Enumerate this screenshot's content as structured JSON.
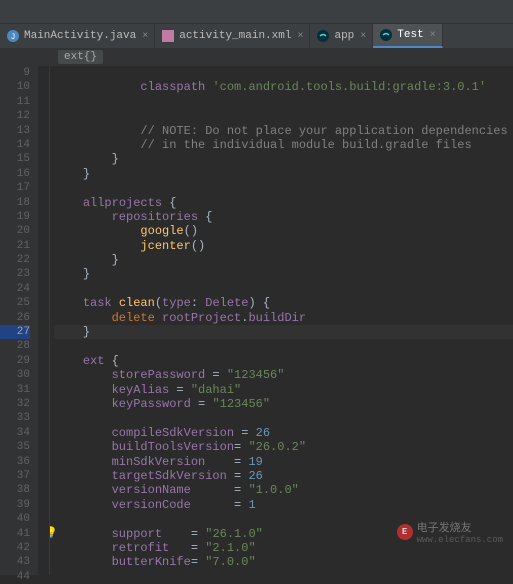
{
  "tabs": [
    {
      "label": "MainActivity.java",
      "icon": "java",
      "active": false
    },
    {
      "label": "activity_main.xml",
      "icon": "xml",
      "active": false
    },
    {
      "label": "app",
      "icon": "gradle",
      "active": false
    },
    {
      "label": "Test",
      "icon": "gradle",
      "active": true
    }
  ],
  "breadcrumb": "ext{}",
  "code_lines": {
    "l9": {
      "indent": 12,
      "tokens": [
        [
          "ident",
          "classpath"
        ],
        [
          "punct",
          " "
        ],
        [
          "str",
          "'com.android.tools.build:gradle:3.0.1'"
        ]
      ]
    },
    "l12": {
      "indent": 12,
      "tokens": [
        [
          "cmt",
          "// NOTE: Do not place your application dependencies her"
        ]
      ]
    },
    "l13": {
      "indent": 12,
      "tokens": [
        [
          "cmt",
          "// in the individual module build.gradle files"
        ]
      ]
    },
    "l14": {
      "indent": 8,
      "tokens": [
        [
          "punct",
          "}"
        ]
      ]
    },
    "l15": {
      "indent": 4,
      "tokens": [
        [
          "punct",
          "}"
        ]
      ]
    },
    "l17": {
      "indent": 4,
      "tokens": [
        [
          "ident",
          "allprojects"
        ],
        [
          "punct",
          " {"
        ]
      ]
    },
    "l18": {
      "indent": 8,
      "tokens": [
        [
          "ident",
          "repositories"
        ],
        [
          "punct",
          " {"
        ]
      ]
    },
    "l19": {
      "indent": 12,
      "tokens": [
        [
          "fn",
          "google"
        ],
        [
          "punct",
          "()"
        ]
      ]
    },
    "l20": {
      "indent": 12,
      "tokens": [
        [
          "fn",
          "jcenter"
        ],
        [
          "punct",
          "()"
        ]
      ]
    },
    "l21": {
      "indent": 8,
      "tokens": [
        [
          "punct",
          "}"
        ]
      ]
    },
    "l22": {
      "indent": 4,
      "tokens": [
        [
          "punct",
          "}"
        ]
      ]
    },
    "l24": {
      "indent": 4,
      "tokens": [
        [
          "ident",
          "task"
        ],
        [
          "punct",
          " "
        ],
        [
          "fn",
          "clean"
        ],
        [
          "punct",
          "("
        ],
        [
          "ident",
          "type"
        ],
        [
          "punct",
          ": "
        ],
        [
          "ident",
          "Delete"
        ],
        [
          "punct",
          ") {"
        ]
      ]
    },
    "l25": {
      "indent": 8,
      "tokens": [
        [
          "kw",
          "delete"
        ],
        [
          "punct",
          " "
        ],
        [
          "ident",
          "rootProject"
        ],
        [
          "punct",
          "."
        ],
        [
          "ident",
          "buildDir"
        ]
      ]
    },
    "l26": {
      "indent": 4,
      "tokens": [
        [
          "punct",
          "}"
        ]
      ]
    },
    "l28": {
      "indent": 4,
      "tokens": [
        [
          "ident",
          "ext"
        ],
        [
          "punct",
          " {"
        ]
      ]
    },
    "l29": {
      "indent": 8,
      "tokens": [
        [
          "ident",
          "storePassword"
        ],
        [
          "punct",
          " = "
        ],
        [
          "str",
          "\"123456\""
        ]
      ]
    },
    "l30": {
      "indent": 8,
      "tokens": [
        [
          "ident",
          "keyAlias"
        ],
        [
          "punct",
          " = "
        ],
        [
          "str",
          "\"dahai\""
        ]
      ]
    },
    "l31": {
      "indent": 8,
      "tokens": [
        [
          "ident",
          "keyPassword"
        ],
        [
          "punct",
          " = "
        ],
        [
          "str",
          "\"123456\""
        ]
      ]
    },
    "l33": {
      "indent": 8,
      "tokens": [
        [
          "ident",
          "compileSdkVersion"
        ],
        [
          "punct",
          " = "
        ],
        [
          "num",
          "26"
        ]
      ]
    },
    "l34": {
      "indent": 8,
      "tokens": [
        [
          "ident",
          "buildToolsVersion"
        ],
        [
          "punct",
          "= "
        ],
        [
          "str",
          "\"26.0.2\""
        ]
      ]
    },
    "l35": {
      "indent": 8,
      "tokens": [
        [
          "ident",
          "minSdkVersion"
        ],
        [
          "punct",
          "    = "
        ],
        [
          "num",
          "19"
        ]
      ]
    },
    "l36": {
      "indent": 8,
      "tokens": [
        [
          "ident",
          "targetSdkVersion"
        ],
        [
          "punct",
          " = "
        ],
        [
          "num",
          "26"
        ]
      ]
    },
    "l37": {
      "indent": 8,
      "tokens": [
        [
          "ident",
          "versionName"
        ],
        [
          "punct",
          "      = "
        ],
        [
          "str",
          "\"1.0.0\""
        ]
      ]
    },
    "l38": {
      "indent": 8,
      "tokens": [
        [
          "ident",
          "versionCode"
        ],
        [
          "punct",
          "      = "
        ],
        [
          "num",
          "1"
        ]
      ]
    },
    "l40": {
      "indent": 8,
      "tokens": [
        [
          "ident",
          "support"
        ],
        [
          "punct",
          "    = "
        ],
        [
          "str",
          "\"26.1.0\""
        ]
      ]
    },
    "l41": {
      "indent": 8,
      "tokens": [
        [
          "ident",
          "retrofit"
        ],
        [
          "punct",
          "   = "
        ],
        [
          "str",
          "\"2.1.0\""
        ]
      ]
    },
    "l42": {
      "indent": 8,
      "tokens": [
        [
          "ident",
          "butterKnife"
        ],
        [
          "punct",
          "= "
        ],
        [
          "str",
          "\"7.0.0\""
        ]
      ]
    }
  },
  "line_numbers": [
    9,
    10,
    11,
    12,
    13,
    14,
    15,
    16,
    17,
    18,
    19,
    20,
    21,
    22,
    23,
    24,
    25,
    26,
    27,
    28,
    29,
    30,
    31,
    32,
    33,
    34,
    35,
    36,
    37,
    38,
    39,
    40,
    41,
    42,
    43,
    44
  ],
  "active_line": 27,
  "watermark": "电子发烧友",
  "watermark_url": "www.elecfans.com"
}
